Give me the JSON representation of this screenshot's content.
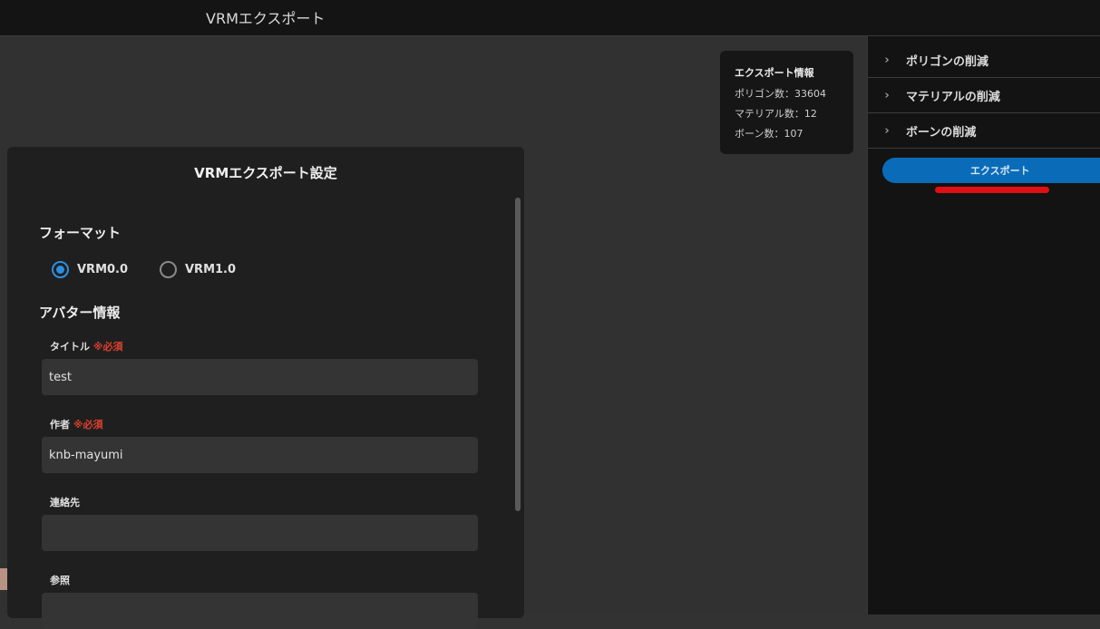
{
  "app": {
    "title": "VRMエクスポート"
  },
  "info": {
    "heading": "エクスポート情報",
    "polygons": "ポリゴン数：33604",
    "materials": "マテリアル数：12",
    "bones": "ボーン数：107"
  },
  "dialog": {
    "title": "VRMエクスポート設定",
    "format_heading": "フォーマット",
    "format_options": [
      {
        "label": "VRM0.0",
        "selected": true
      },
      {
        "label": "VRM1.0",
        "selected": false
      }
    ],
    "avatar_heading": "アバター情報",
    "fields": [
      {
        "label": "タイトル",
        "required": "※必須",
        "value": "test"
      },
      {
        "label": "作者",
        "required": "※必須",
        "value": "knb-mayumi"
      },
      {
        "label": "連絡先",
        "required": "",
        "value": ""
      },
      {
        "label": "参照",
        "required": "",
        "value": ""
      }
    ]
  },
  "sidebar": {
    "items": [
      {
        "label": "ポリゴンの削減",
        "icon": "chevron-right-icon"
      },
      {
        "label": "マテリアルの削減",
        "icon": "chevron-right-icon"
      },
      {
        "label": "ボーンの削減",
        "icon": "chevron-right-icon"
      }
    ],
    "export_button": "エクスポート"
  },
  "colors": {
    "accent": "#0a6cb8",
    "radio_selected": "#2d8fe0",
    "required": "#e0402e",
    "annotation": "#e00f14"
  }
}
